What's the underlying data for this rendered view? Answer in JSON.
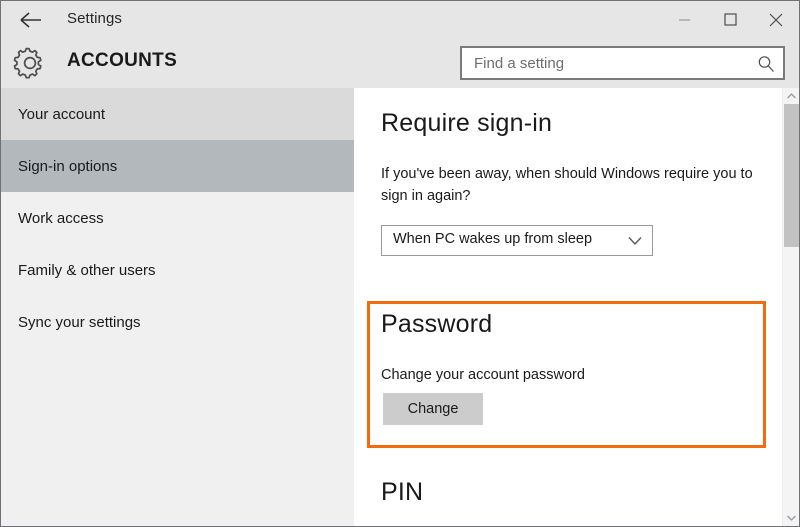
{
  "window": {
    "title": "Settings",
    "back_icon": "back-arrow-icon",
    "controls": {
      "minimize": "minimize-icon",
      "maximize": "maximize-icon",
      "close": "close-icon"
    }
  },
  "header": {
    "icon": "gear-icon",
    "title": "ACCOUNTS"
  },
  "search": {
    "placeholder": "Find a setting",
    "value": "",
    "icon": "search-icon"
  },
  "sidebar": {
    "items": [
      {
        "label": "Your account",
        "state": "hovered"
      },
      {
        "label": "Sign-in options",
        "state": "selected"
      },
      {
        "label": "Work access",
        "state": "normal"
      },
      {
        "label": "Family & other users",
        "state": "normal"
      },
      {
        "label": "Sync your settings",
        "state": "normal"
      }
    ]
  },
  "main": {
    "require_signin": {
      "heading": "Require sign-in",
      "description": "If you've been away, when should Windows require you to sign in again?",
      "dropdown": {
        "value": "When PC wakes up from sleep",
        "chevron_icon": "chevron-down-icon"
      }
    },
    "password": {
      "heading": "Password",
      "description": "Change your account password",
      "button_label": "Change",
      "highlight_color": "#f26c0d"
    },
    "pin": {
      "heading": "PIN"
    }
  },
  "scrollbar": {
    "up_icon": "scroll-up-arrow-icon",
    "down_icon": "scroll-down-arrow-icon"
  },
  "colors": {
    "chrome": "#e6e6e6",
    "sidebar": "#f0f0f0",
    "selected": "#b3b8bd",
    "hovered": "#dadada",
    "accent_orange": "#f26c0d",
    "button_gray": "#cccccc"
  }
}
